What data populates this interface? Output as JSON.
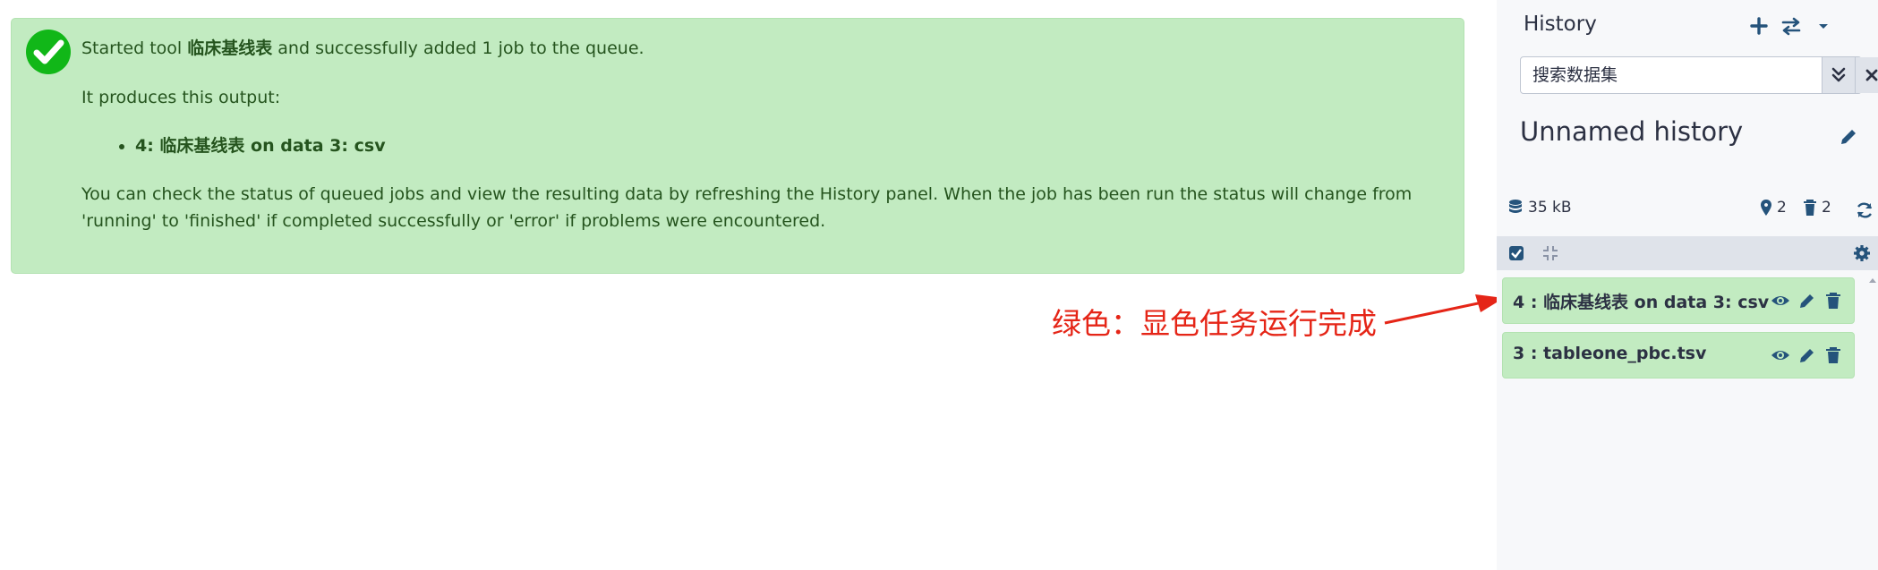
{
  "message": {
    "prefix": "Started tool ",
    "tool_name": "临床基线表",
    "suffix": " and successfully added 1 job to the queue.",
    "produces": "It produces this output:",
    "outputs": [
      "4: 临床基线表 on data 3: csv"
    ],
    "detail": "You can check the status of queued jobs and view the resulting data by refreshing the History panel. When the job has been run the status will change from 'running' to 'finished' if completed successfully or 'error' if problems were encountered."
  },
  "annotation": {
    "text": "绿色：显色任务运行完成",
    "color": "#e52517"
  },
  "history": {
    "title": "History",
    "search_placeholder": "搜索数据集",
    "name": "Unnamed history",
    "size": "35 kB",
    "shown_count": "2",
    "deleted_count": "2",
    "items": [
      {
        "title": "4 : 临床基线表 on data 3: csv",
        "state": "ok"
      },
      {
        "title": "3 : tableone_pbc.tsv",
        "state": "ok"
      }
    ]
  },
  "colors": {
    "success_bg": "#c2ebc1",
    "text": "#2c3143",
    "check_green": "#11b718"
  }
}
